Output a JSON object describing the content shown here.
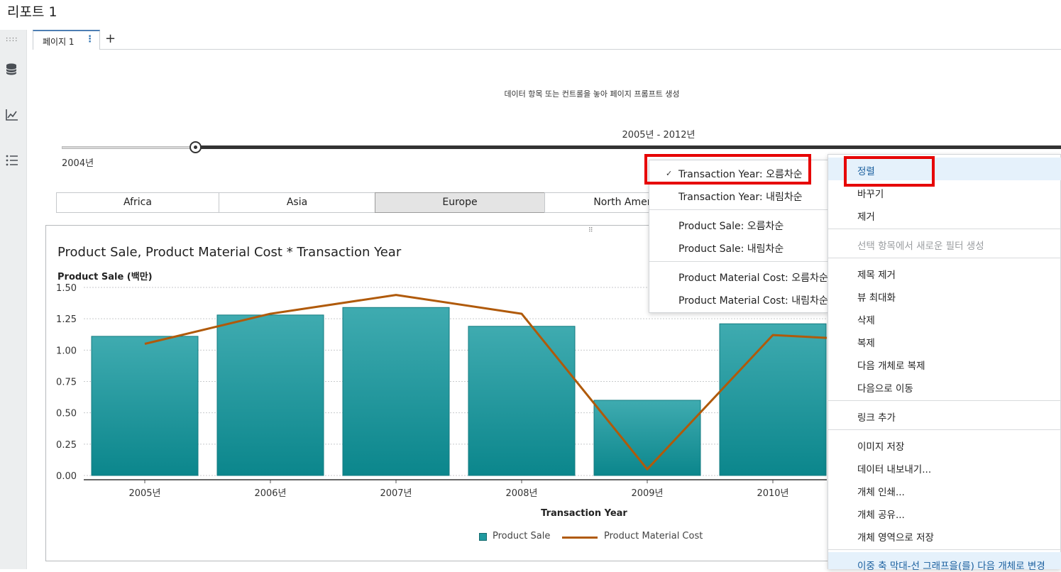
{
  "report": {
    "title": "리포트 1"
  },
  "left_rail": {
    "dots": "::::",
    "icons": [
      "database-icon",
      "line-chart-icon",
      "list-icon"
    ]
  },
  "tabs": [
    {
      "label": "페이지 1",
      "menu_icon": "⋮"
    }
  ],
  "tab_add": "+",
  "prompt": {
    "text": "데이터 항목 또는 컨트롤을 놓아 페이지 프롬프트 생성"
  },
  "slider": {
    "range_label": "2005년 - 2012년",
    "min_label": "2004년"
  },
  "button_bar": {
    "buttons": [
      {
        "label": "Africa",
        "selected": false
      },
      {
        "label": "Asia",
        "selected": false
      },
      {
        "label": "Europe",
        "selected": true
      },
      {
        "label": "North America",
        "selected": false
      }
    ]
  },
  "chart": {
    "title": "Product Sale, Product Material Cost * Transaction Year",
    "y_title": "Product Sale (백만)",
    "x_title": "Transaction Year",
    "legend": [
      {
        "name": "Product Sale",
        "kind": "bar",
        "color": "#1f9aa0"
      },
      {
        "name": "Product Material Cost",
        "kind": "line",
        "color": "#b05a0a"
      }
    ]
  },
  "chart_data": {
    "type": "bar",
    "title": "Product Sale, Product Material Cost * Transaction Year",
    "xlabel": "Transaction Year",
    "ylabel": "Product Sale (백만)",
    "categories": [
      "2005년",
      "2006년",
      "2007년",
      "2008년",
      "2009년",
      "2010년"
    ],
    "yticks": [
      "0.00",
      "0.25",
      "0.50",
      "0.75",
      "1.00",
      "1.25",
      "1.50"
    ],
    "ylim": [
      0,
      1.5
    ],
    "grid": true,
    "legend_position": "bottom",
    "series": [
      {
        "name": "Product Sale",
        "kind": "bar",
        "color": "#1f9aa0",
        "values": [
          1.11,
          1.28,
          1.34,
          1.19,
          0.6,
          1.21
        ]
      },
      {
        "name": "Product Material Cost",
        "kind": "line",
        "color": "#b05a0a",
        "values": [
          1.05,
          1.29,
          1.44,
          1.29,
          0.05,
          1.12
        ]
      }
    ]
  },
  "sort_menu": {
    "items": [
      {
        "label": "Transaction Year: 오름차순",
        "checked": true
      },
      {
        "label": "Transaction Year: 내림차순",
        "checked": false
      },
      {
        "label": "Product Sale: 오름차순",
        "checked": false
      },
      {
        "label": "Product Sale: 내림차순",
        "checked": false
      },
      {
        "label": "Product Material Cost: 오름차순",
        "checked": false
      },
      {
        "label": "Product Material Cost: 내림차순",
        "checked": false
      }
    ],
    "check_mark": "✓"
  },
  "context_menu": {
    "items": [
      {
        "label": "정렬",
        "highlighted": true
      },
      {
        "label": "바꾸기"
      },
      {
        "label": "제거"
      },
      {
        "label": "선택 항목에서 새로운 필터 생성",
        "disabled": true
      },
      {
        "label": "제목 제거"
      },
      {
        "label": "뷰 최대화"
      },
      {
        "label": "삭제"
      },
      {
        "label": "복제"
      },
      {
        "label": "다음 개체로 복제"
      },
      {
        "label": "다음으로 이동"
      },
      {
        "label": "링크 추가"
      },
      {
        "label": "이미지 저장"
      },
      {
        "label": "데이터 내보내기..."
      },
      {
        "label": "개체 인쇄..."
      },
      {
        "label": "개체 공유..."
      },
      {
        "label": "개체 영역으로 저장"
      },
      {
        "label": "이중 축 막대-선 그래프을(를) 다음 개체로 변경",
        "highlighted": true
      }
    ]
  },
  "colors": {
    "accent": "#1a5f9e",
    "bar_top": "#3aa8ad",
    "bar_bottom": "#0e8a90",
    "line": "#b05a0a",
    "highlight_box": "#e60000"
  }
}
